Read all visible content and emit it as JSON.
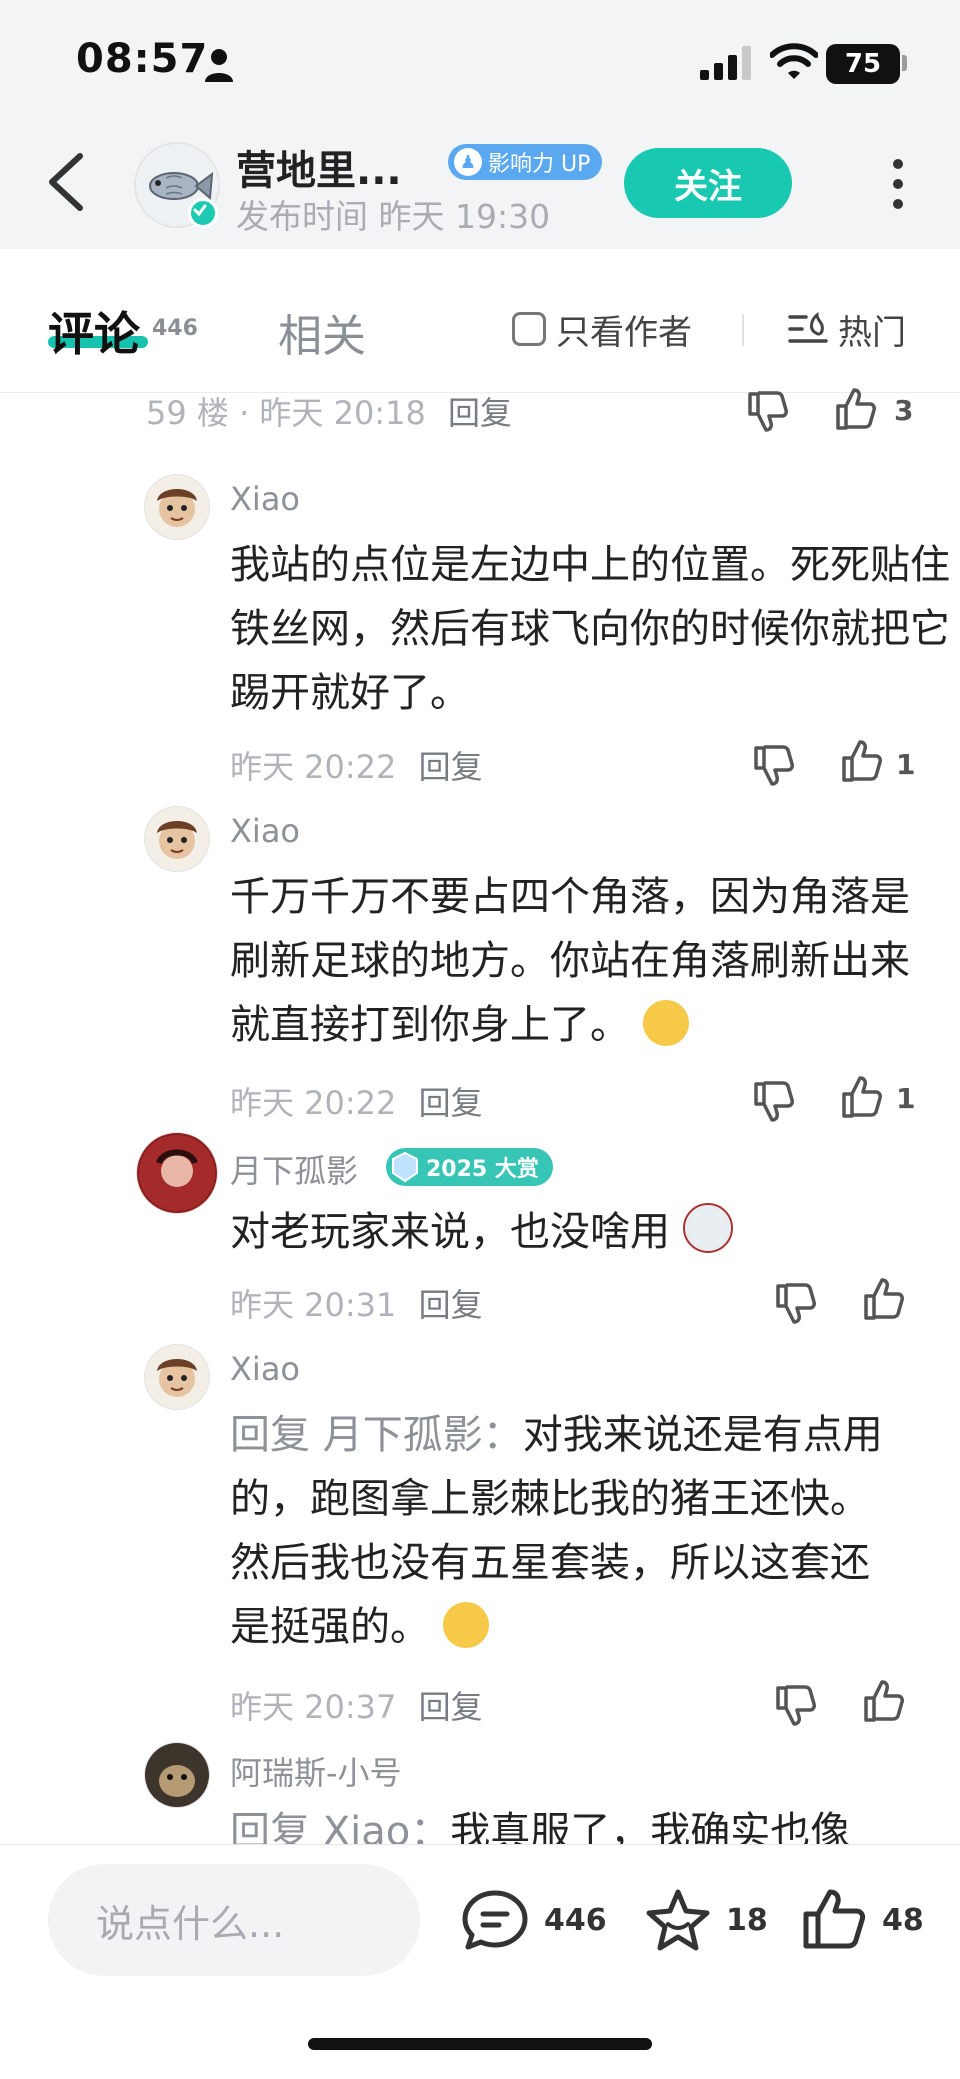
{
  "status_bar": {
    "time": "08:57",
    "battery": "75"
  },
  "header": {
    "author_name": "营地里...",
    "badge_label": "影响力 UP",
    "publish_time": "发布时间  昨天 19:30",
    "follow_label": "关注"
  },
  "tabs": {
    "comments_label": "评论",
    "comments_count": "446",
    "related_label": "相关",
    "only_author_label": "只看作者",
    "sort_label": "热门"
  },
  "comments": [
    {
      "meta": "59 楼 · 昨天 20:18",
      "reply_label": "回复",
      "likes": "3"
    },
    {
      "user": "Xiao",
      "text": "我站的点位是左边中上的位置。死死贴住铁丝网，然后有球飞向你的时候你就把它踢开就好了。",
      "time": "昨天 20:22",
      "reply_label": "回复",
      "likes": "1"
    },
    {
      "user": "Xiao",
      "text": "千万千万不要占四个角落，因为角落是刷新足球的地方。你站在角落刷新出来就直接打到你身上了。",
      "time": "昨天 20:22",
      "reply_label": "回复",
      "likes": "1"
    },
    {
      "user": "月下孤影",
      "badge": "2025 大赏",
      "text": "对老玩家来说，也没啥用",
      "time": "昨天 20:31",
      "reply_label": "回复",
      "likes": ""
    },
    {
      "user": "Xiao",
      "reply_prefix": "回复 月下孤影：",
      "text": "对我来说还是有点用的，跑图拿上影棘比我的猪王还快。然后我也没有五星套装，所以这套还是挺强的。",
      "time": "昨天 20:37",
      "reply_label": "回复",
      "likes": ""
    },
    {
      "user": "阿瑞斯-小号",
      "reply_prefix": "回复 Xiao：",
      "text": "我真服了，我确实也像"
    }
  ],
  "bottom_bar": {
    "input_placeholder": "说点什么...",
    "comment_count": "446",
    "favorite_count": "18",
    "like_count": "48"
  },
  "colors": {
    "accent": "#19c8b0",
    "badge_blue": "#5aa8ef",
    "muted": "#b0b4ba"
  }
}
